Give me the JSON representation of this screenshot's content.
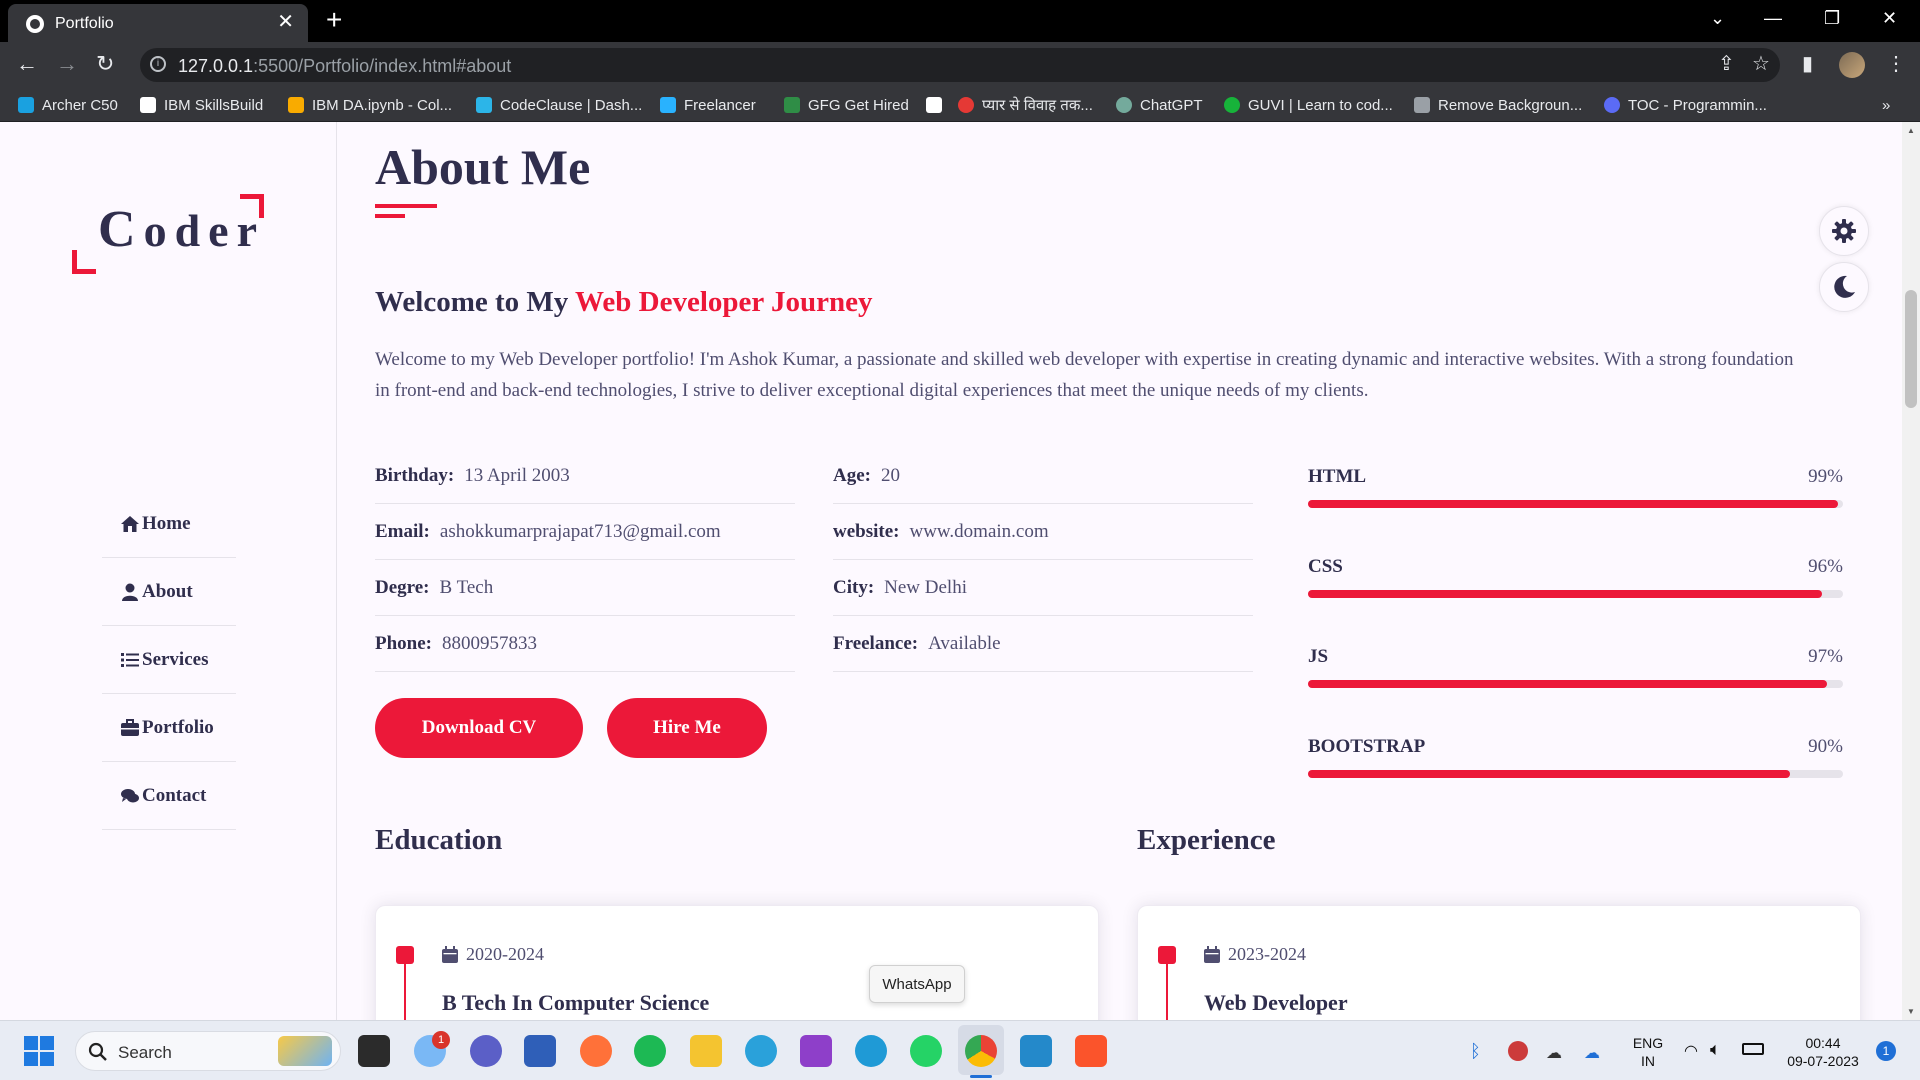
{
  "browser": {
    "tab_title": "Portfolio",
    "url_host": "127.0.0.1",
    "url_path": ":5500/Portfolio/index.html#about",
    "bookmarks": [
      {
        "label": "Archer C50",
        "color": "#1aa1e0"
      },
      {
        "label": "IBM SkillsBuild",
        "color": "#ffffff"
      },
      {
        "label": "IBM DA.ipynb - Col...",
        "color": "#f9ab00"
      },
      {
        "label": "CodeClause | Dash...",
        "color": "#2cb5e8"
      },
      {
        "label": "Freelancer",
        "color": "#29b2fe"
      },
      {
        "label": "GFG Get Hired",
        "color": "#2f8d46"
      },
      {
        "label": "",
        "color": "#ffffff"
      },
      {
        "label": "प्यार से विवाह तक...",
        "color": "#e53935"
      },
      {
        "label": "ChatGPT",
        "color": "#74aa9c"
      },
      {
        "label": "GUVI | Learn to cod...",
        "color": "#17b33a"
      },
      {
        "label": "Remove Backgroun...",
        "color": "#9aa0a6"
      },
      {
        "label": "TOC - Programmin...",
        "color": "#5b6bf5"
      }
    ],
    "more_bookmarks": "»"
  },
  "logo": {
    "first": "C",
    "rest": "oder"
  },
  "nav": [
    {
      "label": "Home",
      "icon": "home-icon"
    },
    {
      "label": "About",
      "icon": "user-icon"
    },
    {
      "label": "Services",
      "icon": "list-icon"
    },
    {
      "label": "Portfolio",
      "icon": "briefcase-icon"
    },
    {
      "label": "Contact",
      "icon": "comments-icon"
    }
  ],
  "about": {
    "heading": "About Me",
    "welcome_prefix": "Welcome to My ",
    "welcome_accent": "Web Developer Journey",
    "intro": "Welcome to my Web Developer portfolio! I'm Ashok Kumar, a passionate and skilled web developer with expertise in creating dynamic and interactive websites. With a strong foundation in front-end and back-end technologies, I strive to deliver exceptional digital experiences that meet the unique needs of my clients.",
    "info_left": [
      {
        "key": "Birthday:",
        "value": "13 April 2003"
      },
      {
        "key": "Email:",
        "value": "ashokkumarprajapat713@gmail.com"
      },
      {
        "key": "Degre:",
        "value": "B Tech"
      },
      {
        "key": "Phone:",
        "value": "8800957833"
      }
    ],
    "info_right": [
      {
        "key": "Age:",
        "value": "20"
      },
      {
        "key": "website:",
        "value": "www.domain.com"
      },
      {
        "key": "City:",
        "value": "New Delhi"
      },
      {
        "key": "Freelance:",
        "value": "Available"
      }
    ],
    "download_cv": "Download CV",
    "hire_me": "Hire Me",
    "skills": [
      {
        "name": "HTML",
        "percent_label": "99%",
        "level": 0.99
      },
      {
        "name": "CSS",
        "percent_label": "96%",
        "level": 0.96
      },
      {
        "name": "JS",
        "percent_label": "97%",
        "level": 0.97
      },
      {
        "name": "BOOTSTRAP",
        "percent_label": "90%",
        "level": 0.9
      }
    ],
    "education_title": "Education",
    "experience_title": "Experience",
    "education_item": {
      "date": "2020-2024",
      "title": "B Tech In Computer Science"
    },
    "experience_item": {
      "date": "2023-2024",
      "title": "Web Developer"
    }
  },
  "accent_color": "#ec1839",
  "tooltip": "WhatsApp",
  "taskbar": {
    "search_label": "Search",
    "notification_count": "1",
    "language_top": "ENG",
    "language_bottom": "IN",
    "time": "00:44",
    "date": "09-07-2023",
    "notif_badge": "1"
  }
}
